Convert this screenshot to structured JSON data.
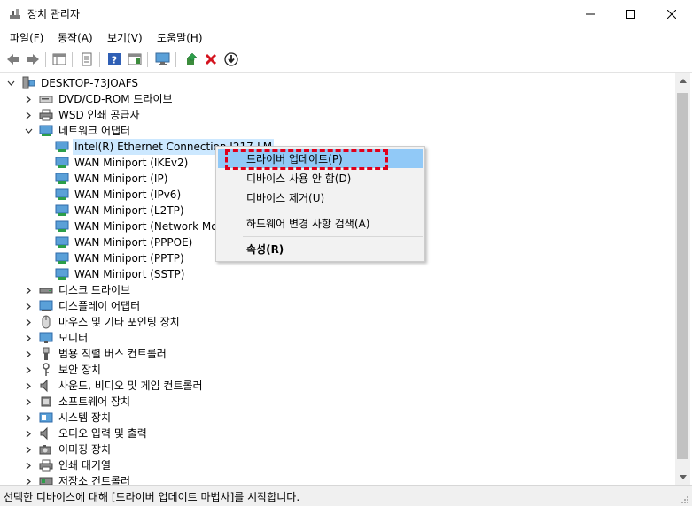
{
  "window": {
    "title": "장치 관리자",
    "controls": [
      "minimize",
      "maximize",
      "close"
    ]
  },
  "menubar": {
    "items": [
      "파일(F)",
      "동작(A)",
      "보기(V)",
      "도움말(H)"
    ]
  },
  "toolbar": {
    "icons": [
      "back-icon",
      "forward-icon",
      "properties-pane-icon",
      "device-list-icon",
      "help-icon",
      "action-pane-icon",
      "monitor-scan-icon",
      "update-driver-icon",
      "uninstall-icon",
      "download-icon"
    ]
  },
  "tree": {
    "root": "DESKTOP-73JOAFS",
    "categories_top": [
      "DVD/CD-ROM 드라이브",
      "WSD 인쇄 공급자"
    ],
    "network": {
      "label": "네트워크 어댑터",
      "children": [
        "Intel(R) Ethernet Connection I217-LM",
        "WAN Miniport (IKEv2)",
        "WAN Miniport (IP)",
        "WAN Miniport (IPv6)",
        "WAN Miniport (L2TP)",
        "WAN Miniport (Network Monitor)",
        "WAN Miniport (PPPOE)",
        "WAN Miniport (PPTP)",
        "WAN Miniport (SSTP)"
      ]
    },
    "categories_bottom": [
      "디스크 드라이브",
      "디스플레이 어댑터",
      "마우스 및 기타 포인팅 장치",
      "모니터",
      "범용 직렬 버스 컨트롤러",
      "보안 장치",
      "사운드, 비디오 및 게임 컨트롤러",
      "소프트웨어 장치",
      "시스템 장치",
      "오디오 입력 및 출력",
      "이미징 장치",
      "인쇄 대기열",
      "저장소 컨트롤러"
    ]
  },
  "context_menu": {
    "items": [
      "드라이버 업데이트(P)",
      "디바이스 사용 안 함(D)",
      "디바이스 제거(U)",
      "하드웨어 변경 사항 검색(A)",
      "속성(R)"
    ],
    "highlighted": "드라이버 업데이트(P)",
    "annotation_color": "#e0001b"
  },
  "statusbar": {
    "text": "선택한 디바이스에 대해 [드라이버 업데이트 마법사]를 시작합니다."
  },
  "colors": {
    "selection": "#cce8ff",
    "menu_highlight": "#91c9f7",
    "accent_blue": "#1f6fc5",
    "network_green": "#2c9e4a"
  }
}
